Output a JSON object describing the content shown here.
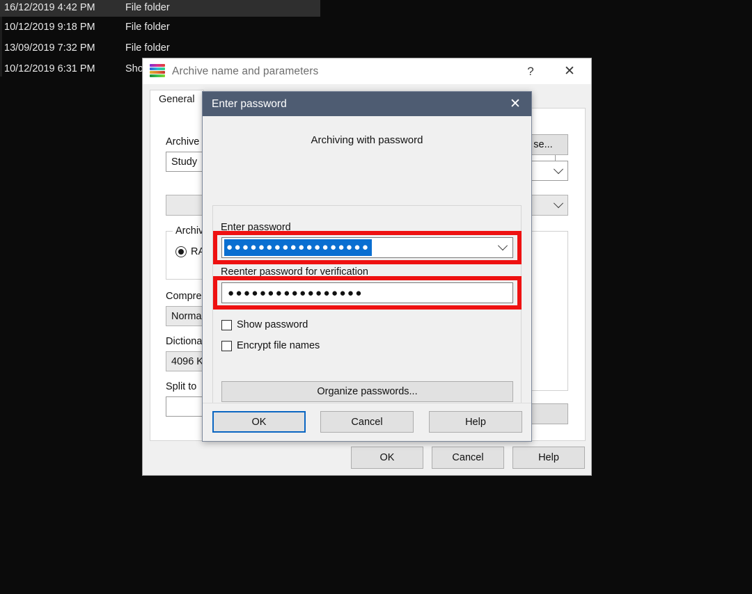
{
  "explorer": {
    "rows": [
      {
        "date": "16/12/2019 4:42 PM",
        "type": "File folder",
        "selected": true
      },
      {
        "date": "10/12/2019 9:18 PM",
        "type": "File folder",
        "selected": false
      },
      {
        "date": "13/09/2019 7:32 PM",
        "type": "File folder",
        "selected": false
      },
      {
        "date": "10/12/2019 6:31 PM",
        "type": "Sho",
        "selected": false
      }
    ]
  },
  "winrar": {
    "title": "Archive name and parameters",
    "help_glyph": "?",
    "close_glyph": "✕",
    "tab_general": "General",
    "archive_name_label": "Archive",
    "archive_name_value": "Study",
    "browse_label": "se...",
    "archive_format_group": "Archiv",
    "format_rar_label": "RA",
    "compression_label": "Compre",
    "compression_value": "Norma",
    "dictionary_label": "Dictiona",
    "dictionary_value": "4096 K",
    "split_label": "Split to",
    "split_value": "",
    "profile_value": "",
    "buttons": {
      "ok": "OK",
      "cancel": "Cancel",
      "help": "Help"
    }
  },
  "password_dialog": {
    "title": "Enter password",
    "close_glyph": "✕",
    "heading": "Archiving with password",
    "enter_password_label": "Enter password",
    "enter_password_value": "●●●●●●●●●●●●●●●●●●",
    "reenter_password_label": "Reenter password for verification",
    "reenter_password_value": "●●●●●●●●●●●●●●●●●",
    "show_password_label": "Show password",
    "show_password_checked": false,
    "encrypt_file_names_label": "Encrypt file names",
    "encrypt_file_names_checked": false,
    "organize_passwords_label": "Organize passwords...",
    "buttons": {
      "ok": "OK",
      "cancel": "Cancel",
      "help": "Help"
    }
  },
  "colors": {
    "highlight_red": "#ee1111",
    "pw_titlebar": "#4e5c72",
    "selection_blue": "#0a6fd1",
    "focus_blue": "#0a66c2",
    "dialog_face": "#f0f0f0"
  }
}
